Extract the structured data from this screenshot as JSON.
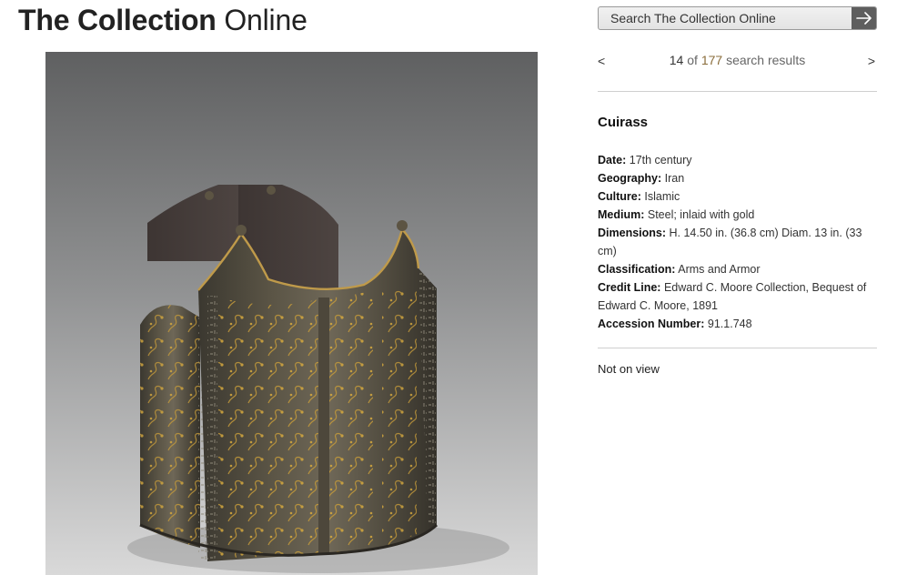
{
  "header": {
    "title_bold": "The Collection",
    "title_light": "Online"
  },
  "search": {
    "placeholder": "Search The Collection Online",
    "submit_icon": "arrow-right-icon"
  },
  "pager": {
    "prev": "<",
    "next": ">",
    "current": "14",
    "of": "of",
    "total": "177",
    "suffix": "search results"
  },
  "object": {
    "title": "Cuirass",
    "facts": [
      {
        "label": "Date:",
        "value": "17th century"
      },
      {
        "label": "Geography:",
        "value": "Iran"
      },
      {
        "label": "Culture:",
        "value": "Islamic"
      },
      {
        "label": "Medium:",
        "value": "Steel; inlaid with gold"
      },
      {
        "label": "Dimensions:",
        "value": "H. 14.50 in. (36.8 cm) Diam. 13 in. (33 cm)"
      },
      {
        "label": "Classification:",
        "value": "Arms and Armor"
      },
      {
        "label": "Credit Line:",
        "value": "Edward C. Moore Collection, Bequest of Edward C. Moore, 1891"
      },
      {
        "label": "Accession Number:",
        "value": "91.1.748"
      }
    ],
    "on_view_status": "Not on view"
  },
  "colors": {
    "search_button": "#5e5e5e",
    "link_accent": "#8a6d3b",
    "rule": "#cfcfcf"
  }
}
